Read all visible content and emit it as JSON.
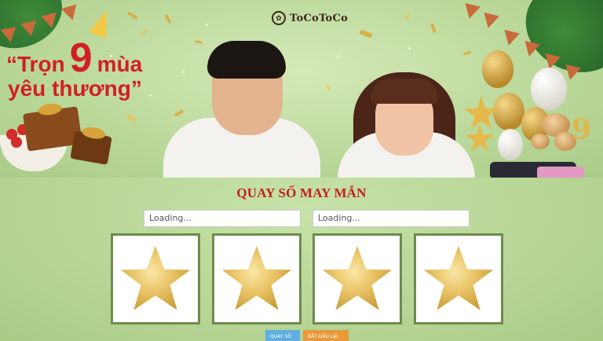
{
  "banner": {
    "logo": "ToCoToCo",
    "slogan": {
      "open_quote": "“",
      "tron": "Trọn",
      "nine": "9",
      "mua": "mùa",
      "line2": "yêu thương”"
    },
    "big_number": "9"
  },
  "lottery": {
    "title": "QUAY SỐ MAY MẮN",
    "inputs": [
      {
        "value": "Loading..."
      },
      {
        "value": "Loading..."
      }
    ],
    "cards": [
      {
        "icon": "gold-star-balloon-icon"
      },
      {
        "icon": "gold-star-balloon-icon"
      },
      {
        "icon": "gold-star-balloon-icon"
      },
      {
        "icon": "gold-star-balloon-icon"
      }
    ],
    "buttons": {
      "spin": "QUAY SỐ",
      "reset": "BẮT ĐẦU LẠI"
    }
  },
  "colors": {
    "title_red": "#c21f1f",
    "background_green": "#b9d79a",
    "card_border": "#6f8a4d",
    "spin_button": "#5eaee0",
    "reset_button": "#e89a3a"
  }
}
